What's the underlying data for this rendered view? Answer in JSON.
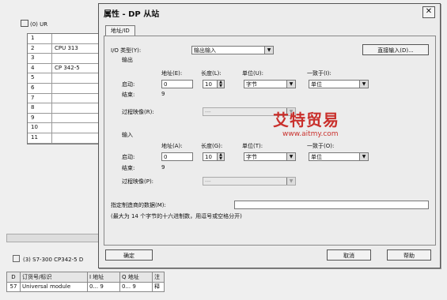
{
  "background": {
    "rack_title": "(0) UR",
    "rack_rows": [
      {
        "slot": "1",
        "module": ""
      },
      {
        "slot": "2",
        "module": "CPU 313"
      },
      {
        "slot": "3",
        "module": ""
      },
      {
        "slot": "4",
        "module": "CP 342-5"
      },
      {
        "slot": "5",
        "module": ""
      },
      {
        "slot": "6",
        "module": ""
      },
      {
        "slot": "7",
        "module": ""
      },
      {
        "slot": "8",
        "module": ""
      },
      {
        "slot": "9",
        "module": ""
      },
      {
        "slot": "10",
        "module": ""
      },
      {
        "slot": "11",
        "module": ""
      }
    ],
    "status_line": "(3)   S7-300 CP342-5 D",
    "table_headers": [
      "D",
      "订货号/标识",
      "I 地址",
      "Q 地址",
      "注释"
    ],
    "table_row": [
      "57",
      "Universal module",
      "0... 9",
      "0... 9",
      ""
    ]
  },
  "dialog": {
    "title": "属性 - DP 从站",
    "close_glyph": "✕",
    "tab": "地址/ID",
    "io_type_label": "I/O 类型(Y):",
    "io_type_value": "输出输入",
    "direct_input_button": "直接输入(D)...",
    "output": {
      "section": "输出",
      "address_label": "地址(E):",
      "length_label": "长度(L):",
      "unit_label": "单位(U):",
      "consistency_label": "一致于(I):",
      "start_label": "启动:",
      "start_value": "0",
      "length_value": "10",
      "unit_value": "字节",
      "consistency_value": "单位",
      "end_label": "结束:",
      "end_value": "9",
      "process_image_label": "过程映像(R):",
      "process_image_value": "---"
    },
    "input": {
      "section": "输入",
      "address_label": "地址(A):",
      "length_label": "长度(G):",
      "unit_label": "单位(T):",
      "consistency_label": "一致于(O):",
      "start_label": "启动:",
      "start_value": "0",
      "length_value": "10",
      "unit_value": "字节",
      "consistency_value": "单位",
      "end_label": "结束:",
      "end_value": "9",
      "process_image_label": "过程映像(P):",
      "process_image_value": "---"
    },
    "vendor_data_label": "指定制造商的数据(M):",
    "vendor_data_value": "",
    "vendor_hint": "(最大为 14 个字节的十六进制数，用逗号或空格分开)",
    "ok_button": "确定",
    "cancel_button": "取消",
    "help_button": "帮助"
  },
  "watermark": {
    "brand": "艾特贸易",
    "url": "www.aitmy.com"
  }
}
